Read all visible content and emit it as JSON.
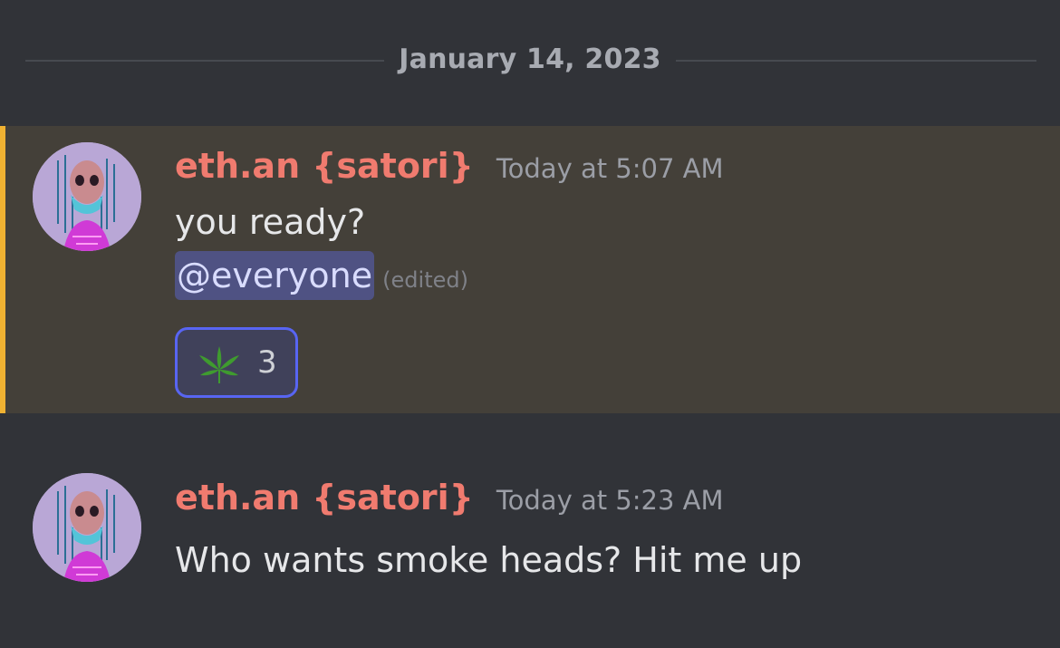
{
  "divider": {
    "date": "January 14, 2023"
  },
  "messages": [
    {
      "username": "eth.an {satori}",
      "timestamp": "Today at 5:07 AM",
      "line1": "you ready?",
      "mention": "@everyone",
      "edited": "(edited)",
      "reaction": {
        "emoji": "leaf-icon",
        "count": "3"
      },
      "highlighted": true
    },
    {
      "username": "eth.an {satori}",
      "timestamp": "Today at 5:23 AM",
      "line1": "Who wants smoke heads? Hit me up",
      "highlighted": false
    }
  ],
  "colors": {
    "background": "#313338",
    "highlight_bg": "#444039",
    "highlight_bar": "#f0b232",
    "username": "#f07b6f",
    "mention_bg": "#4f5283",
    "reaction_border": "#5865f2"
  }
}
